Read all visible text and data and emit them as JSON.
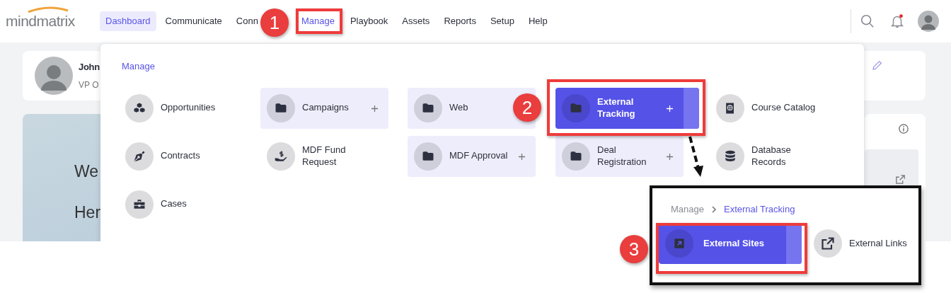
{
  "header": {
    "logo": "mindmatrix",
    "nav": [
      {
        "label": "Dashboard",
        "selected": true,
        "open": false
      },
      {
        "label": "Communicate",
        "selected": false,
        "open": false
      },
      {
        "label": "Conn",
        "selected": false,
        "open": false
      },
      {
        "label": "Manage",
        "selected": false,
        "open": true
      },
      {
        "label": "Playbook",
        "selected": false,
        "open": false
      },
      {
        "label": "Assets",
        "selected": false,
        "open": false
      },
      {
        "label": "Reports",
        "selected": false,
        "open": false
      },
      {
        "label": "Setup",
        "selected": false,
        "open": false
      },
      {
        "label": "Help",
        "selected": false,
        "open": false
      }
    ]
  },
  "profile": {
    "name": "John",
    "title": "VP O"
  },
  "banner": {
    "lines": [
      "We",
      "Her"
    ]
  },
  "menu": {
    "heading": "Manage",
    "columns": [
      [
        {
          "label": "Opportunities",
          "kind": "link",
          "selected": false
        },
        {
          "label": "Contracts",
          "kind": "link",
          "selected": false
        },
        {
          "label": "Cases",
          "kind": "link",
          "selected": false
        }
      ],
      [
        {
          "label": "Campaigns",
          "kind": "folder",
          "expandable": true,
          "selected": false
        },
        {
          "label": "MDF Fund Request",
          "kind": "link",
          "selected": false
        }
      ],
      [
        {
          "label": "Web",
          "kind": "folder",
          "selected": false
        },
        {
          "label": "MDF Approval",
          "kind": "folder",
          "expandable": true,
          "selected": false
        }
      ],
      [
        {
          "label": "External Tracking",
          "kind": "folder",
          "expandable": true,
          "selected": true
        },
        {
          "label": "Deal Registration",
          "kind": "folder",
          "expandable": true,
          "selected": false
        }
      ],
      [
        {
          "label": "Course Catalog",
          "kind": "link",
          "selected": false
        },
        {
          "label": "Database Records",
          "kind": "link",
          "selected": false
        }
      ]
    ]
  },
  "submenu": {
    "breadcrumb": [
      "Manage",
      "External Tracking"
    ],
    "items": [
      {
        "label": "External Sites",
        "selected": true
      },
      {
        "label": "External Links",
        "selected": false
      }
    ]
  },
  "annotations": {
    "steps": [
      "1",
      "2",
      "3"
    ]
  }
}
